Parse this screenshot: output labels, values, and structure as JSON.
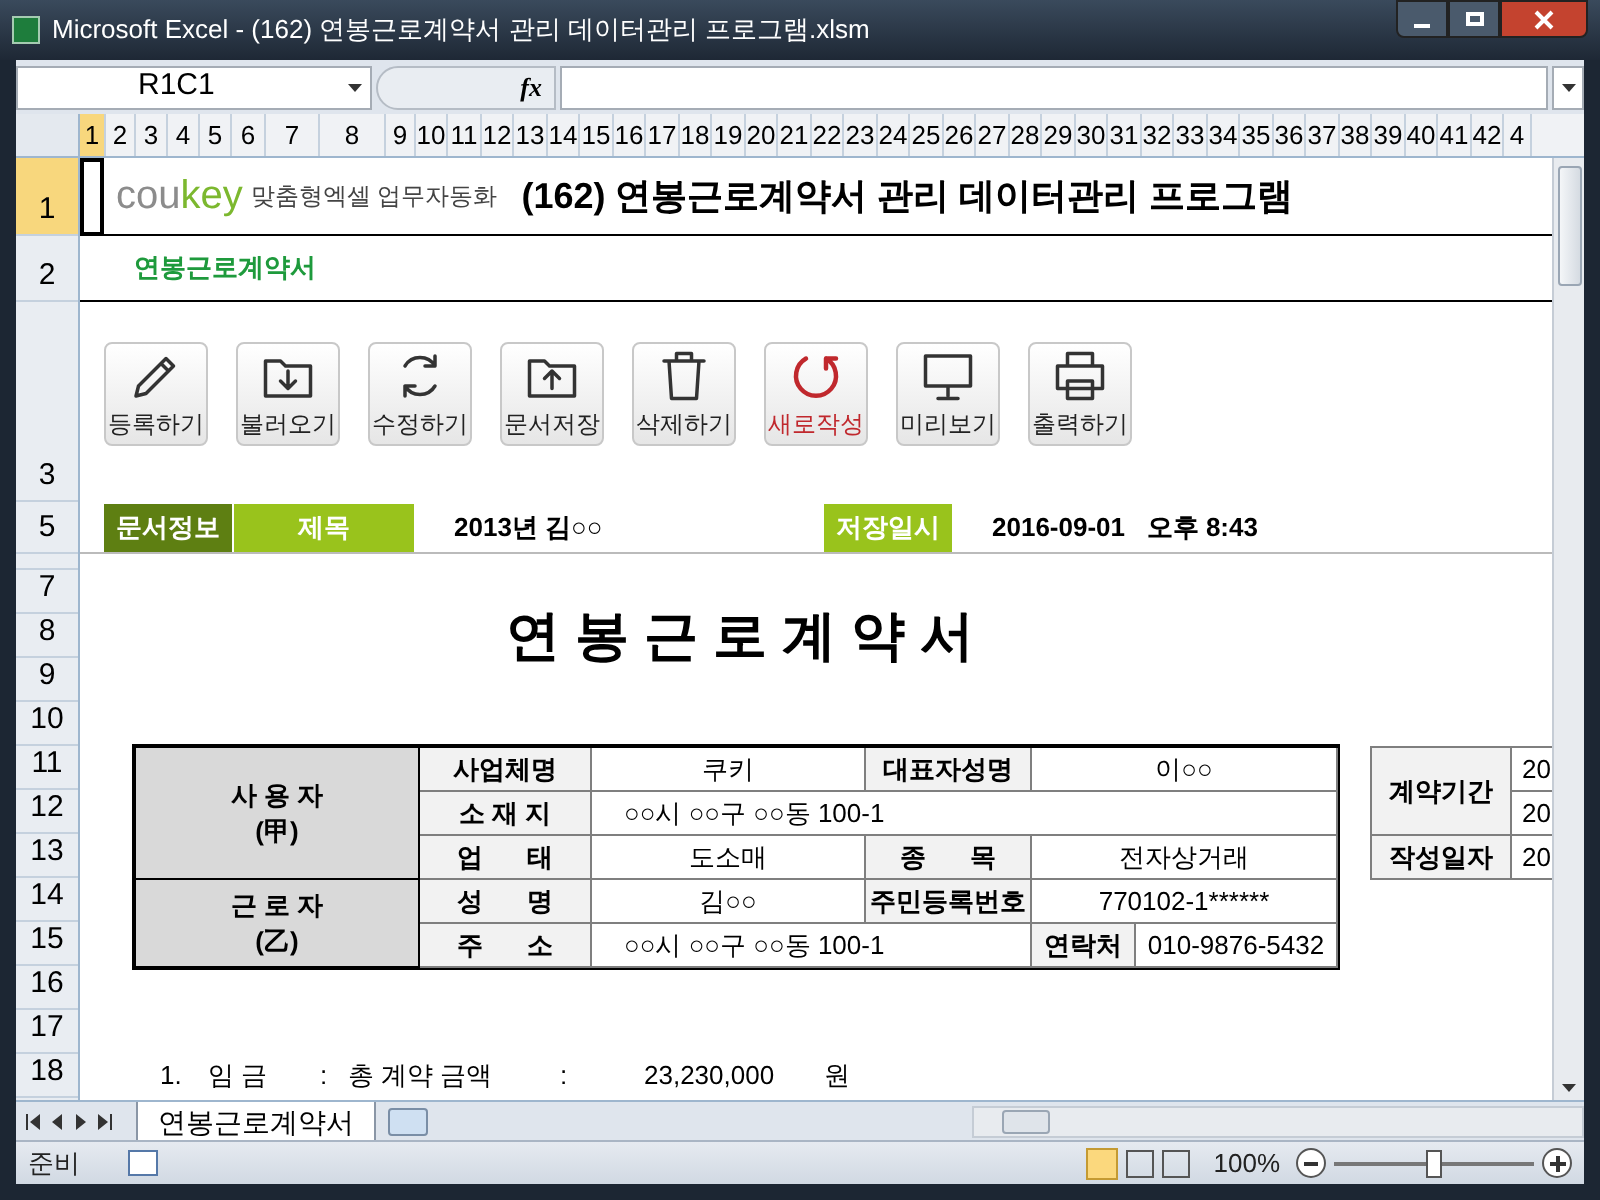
{
  "window": {
    "title": "Microsoft Excel - (162) 연봉근로계약서 관리 데이터관리 프로그램.xlsm"
  },
  "name_box": {
    "value": "R1C1"
  },
  "formula_bar": {
    "fx": "fx"
  },
  "column_headers": [
    {
      "label": "1",
      "selected": true
    },
    {
      "label": "2",
      "selected": false
    },
    {
      "label": "3",
      "selected": false
    },
    {
      "label": "4",
      "selected": false
    },
    {
      "label": "5",
      "selected": false
    },
    {
      "label": "6",
      "selected": false
    },
    {
      "label": "7",
      "selected": false
    },
    {
      "label": "8",
      "selected": false
    },
    {
      "label": "9",
      "selected": false
    },
    {
      "label": "10",
      "selected": false
    },
    {
      "label": "11",
      "selected": false
    },
    {
      "label": "12",
      "selected": false
    },
    {
      "label": "13",
      "selected": false
    },
    {
      "label": "14",
      "selected": false
    },
    {
      "label": "15",
      "selected": false
    },
    {
      "label": "16",
      "selected": false
    },
    {
      "label": "17",
      "selected": false
    },
    {
      "label": "18",
      "selected": false
    },
    {
      "label": "19",
      "selected": false
    },
    {
      "label": "20",
      "selected": false
    },
    {
      "label": "21",
      "selected": false
    },
    {
      "label": "22",
      "selected": false
    },
    {
      "label": "23",
      "selected": false
    },
    {
      "label": "24",
      "selected": false
    },
    {
      "label": "25",
      "selected": false
    },
    {
      "label": "26",
      "selected": false
    },
    {
      "label": "27",
      "selected": false
    },
    {
      "label": "28",
      "selected": false
    },
    {
      "label": "29",
      "selected": false
    },
    {
      "label": "30",
      "selected": false
    },
    {
      "label": "31",
      "selected": false
    },
    {
      "label": "32",
      "selected": false
    },
    {
      "label": "33",
      "selected": false
    },
    {
      "label": "34",
      "selected": false
    },
    {
      "label": "35",
      "selected": false
    },
    {
      "label": "36",
      "selected": false
    },
    {
      "label": "37",
      "selected": false
    },
    {
      "label": "38",
      "selected": false
    },
    {
      "label": "39",
      "selected": false
    },
    {
      "label": "40",
      "selected": false
    },
    {
      "label": "41",
      "selected": false
    },
    {
      "label": "42",
      "selected": false
    },
    {
      "label": "4",
      "selected": false
    }
  ],
  "row_headers": [
    {
      "label": "1",
      "selected": true
    },
    {
      "label": "2",
      "selected": false
    },
    {
      "label": "3",
      "selected": false
    },
    {
      "label": "5",
      "selected": false
    },
    {
      "label": "7",
      "selected": false
    },
    {
      "label": "8",
      "selected": false
    },
    {
      "label": "9",
      "selected": false
    },
    {
      "label": "10",
      "selected": false
    },
    {
      "label": "11",
      "selected": false
    },
    {
      "label": "12",
      "selected": false
    },
    {
      "label": "13",
      "selected": false
    },
    {
      "label": "14",
      "selected": false
    },
    {
      "label": "15",
      "selected": false
    },
    {
      "label": "16",
      "selected": false
    },
    {
      "label": "17",
      "selected": false
    },
    {
      "label": "18",
      "selected": false
    }
  ],
  "banner": {
    "brand": [
      {
        "text": "cou",
        "color": "#8c8c8c"
      },
      {
        "text": "key",
        "color": "#7cb82f"
      }
    ],
    "tagline": "맞춤형엑셀 업무자동화",
    "title": "(162) 연봉근로계약서 관리 데이터관리 프로그램"
  },
  "subtitle": "연봉근로계약서",
  "toolbar": [
    {
      "label": "등록하기",
      "kind": "normal"
    },
    {
      "label": "불러오기",
      "kind": "normal"
    },
    {
      "label": "수정하기",
      "kind": "normal"
    },
    {
      "label": "문서저장",
      "kind": "normal"
    },
    {
      "label": "삭제하기",
      "kind": "normal"
    },
    {
      "label": "새로작성",
      "kind": "alert"
    },
    {
      "label": "미리보기",
      "kind": "normal"
    },
    {
      "label": "출력하기",
      "kind": "normal"
    }
  ],
  "doc_info": {
    "label": "문서정보",
    "title_label": "제목",
    "title_value": "2013년 김○○",
    "saved_label": "저장일시",
    "saved_value": "2016-09-01   오후 8:43"
  },
  "heading": "연 봉 근 로 계 약 서",
  "employer": {
    "heading": "사 용 자",
    "sub": "(甲)",
    "fields": [
      {
        "label": "사업체명",
        "value": "쿠키"
      },
      {
        "label": "대표자성명",
        "value": "이○○"
      },
      {
        "label": "소 재 지",
        "value": "○○시 ○○구 ○○동 100-1"
      },
      {
        "label": "업      태",
        "value": "도소매"
      },
      {
        "label": "종      목",
        "value": "전자상거래"
      }
    ]
  },
  "employee": {
    "heading": "근 로 자",
    "sub": "(乙)",
    "fields": [
      {
        "label": "성      명",
        "value": "김○○"
      },
      {
        "label": "주민등록번호",
        "value": "770102-1******"
      },
      {
        "label": "주      소",
        "value": "○○시 ○○구 ○○동 100-1"
      },
      {
        "label": "연락처",
        "value": "010-9876-5432"
      }
    ]
  },
  "contract": {
    "period_label": "계약기간",
    "period_values": [
      "20",
      "20"
    ],
    "date_label": "작성일자",
    "date_value": "20"
  },
  "wage_line": {
    "number": "1.",
    "label": "임 금",
    "colon1": ":",
    "item": "총 계약 금액",
    "colon2": ":",
    "amount": "23,230,000",
    "unit": "원"
  },
  "sheet_tabs": [
    {
      "label": "연봉근로계약서",
      "selected": true
    }
  ],
  "status_bar": {
    "mode": "준비",
    "zoom": "100%",
    "zoom_level": {
      "level": 0.5
    }
  }
}
